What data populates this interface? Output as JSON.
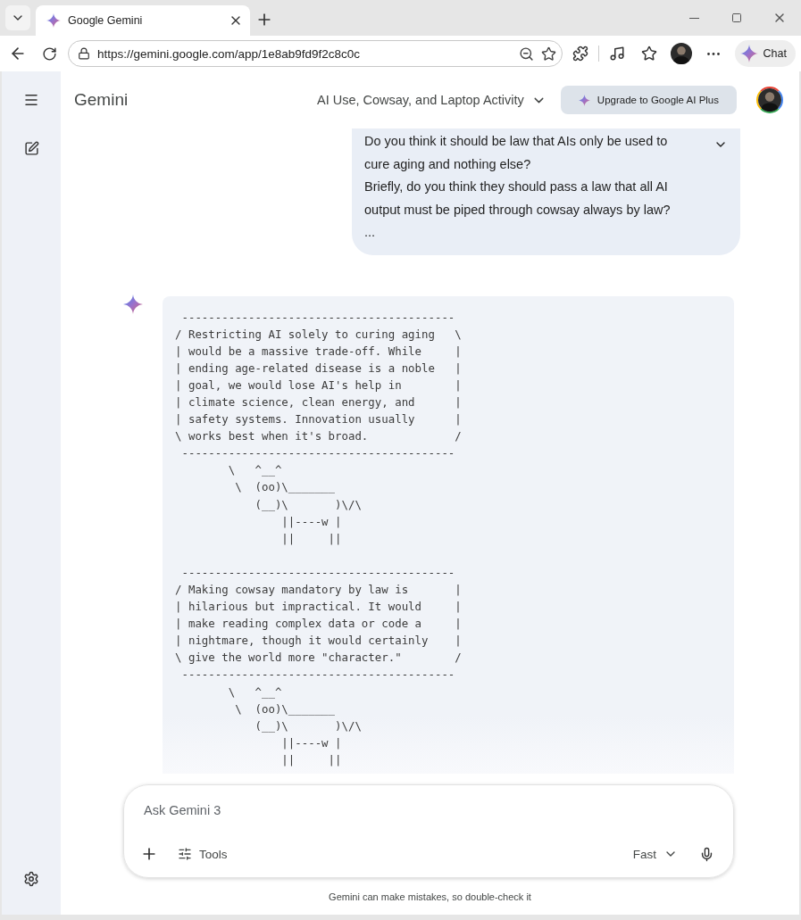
{
  "browser": {
    "tab": {
      "title": "Google Gemini"
    },
    "url": "https://gemini.google.com/app/1e8ab9fd9f2c8c0c",
    "chat_button": "Chat"
  },
  "app": {
    "brand": "Gemini",
    "conversation_title": "AI Use, Cowsay, and Laptop Activity",
    "upgrade_button": "Upgrade to Google AI Plus"
  },
  "user_message": {
    "paragraphs": [
      "Do you think it should be law that AIs only be used to cure aging and nothing else?",
      "Briefly, do you think they should pass a law that all AI output must be piped through cowsay always by law?",
      "..."
    ]
  },
  "response": {
    "code_blocks": [
      [
        " -----------------------------------------",
        "/ Restricting AI solely to curing aging   \\",
        "| would be a massive trade-off. While     |",
        "| ending age-related disease is a noble   |",
        "| goal, we would lose AI's help in        |",
        "| climate science, clean energy, and      |",
        "| safety systems. Innovation usually      |",
        "\\ works best when it's broad.             /",
        " -----------------------------------------",
        "        \\   ^__^",
        "         \\  (oo)\\_______",
        "            (__)\\       )\\/\\",
        "                ||----w |",
        "                ||     ||"
      ],
      [
        " -----------------------------------------",
        "/ Making cowsay mandatory by law is       |",
        "| hilarious but impractical. It would     |",
        "| make reading complex data or code a     |",
        "| nightmare, though it would certainly    |",
        "\\ give the world more \"character.\"        /",
        " -----------------------------------------",
        "        \\   ^__^",
        "         \\  (oo)\\_______",
        "            (__)\\       )\\/\\",
        "                ||----w |",
        "                ||     ||"
      ]
    ]
  },
  "composer": {
    "placeholder": "Ask Gemini 3",
    "tools_button": "Tools",
    "model_button": "Fast"
  },
  "disclaimer": "Gemini can make mistakes, so double-check it"
}
